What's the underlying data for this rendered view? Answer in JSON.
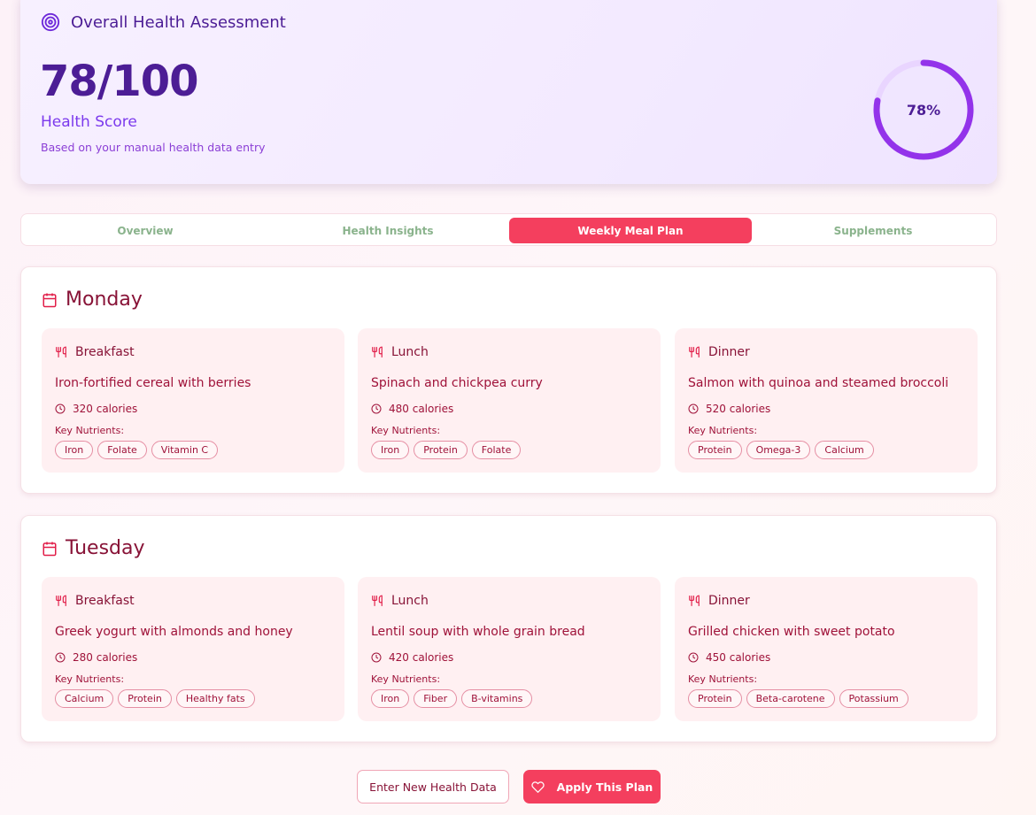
{
  "assessment": {
    "title": "Overall Health Assessment",
    "score": "78/100",
    "score_label": "Health Score",
    "note": "Based on your manual health data entry",
    "percent": 78,
    "percent_text": "78%"
  },
  "tabs": [
    {
      "label": "Overview",
      "active": false
    },
    {
      "label": "Health Insights",
      "active": false
    },
    {
      "label": "Weekly Meal Plan",
      "active": true
    },
    {
      "label": "Supplements",
      "active": false
    }
  ],
  "days": [
    {
      "name": "Monday",
      "meals": [
        {
          "type": "Breakfast",
          "name": "Iron-fortified cereal with berries",
          "calories": "320 calories",
          "nutrients_label": "Key Nutrients:",
          "nutrients": [
            "Iron",
            "Folate",
            "Vitamin C"
          ]
        },
        {
          "type": "Lunch",
          "name": "Spinach and chickpea curry",
          "calories": "480 calories",
          "nutrients_label": "Key Nutrients:",
          "nutrients": [
            "Iron",
            "Protein",
            "Folate"
          ]
        },
        {
          "type": "Dinner",
          "name": "Salmon with quinoa and steamed broccoli",
          "calories": "520 calories",
          "nutrients_label": "Key Nutrients:",
          "nutrients": [
            "Protein",
            "Omega-3",
            "Calcium"
          ]
        }
      ]
    },
    {
      "name": "Tuesday",
      "meals": [
        {
          "type": "Breakfast",
          "name": "Greek yogurt with almonds and honey",
          "calories": "280 calories",
          "nutrients_label": "Key Nutrients:",
          "nutrients": [
            "Calcium",
            "Protein",
            "Healthy fats"
          ]
        },
        {
          "type": "Lunch",
          "name": "Lentil soup with whole grain bread",
          "calories": "420 calories",
          "nutrients_label": "Key Nutrients:",
          "nutrients": [
            "Iron",
            "Fiber",
            "B-vitamins"
          ]
        },
        {
          "type": "Dinner",
          "name": "Grilled chicken with sweet potato",
          "calories": "450 calories",
          "nutrients_label": "Key Nutrients:",
          "nutrients": [
            "Protein",
            "Beta-carotene",
            "Potassium"
          ]
        }
      ]
    }
  ],
  "actions": {
    "secondary_label": "Enter New Health Data",
    "primary_label": "Apply This Plan"
  },
  "colors": {
    "accent": "#f43f5e",
    "purple": "#4c1d95",
    "ring": "#9333ea",
    "ring_track": "#e9d5ff"
  }
}
